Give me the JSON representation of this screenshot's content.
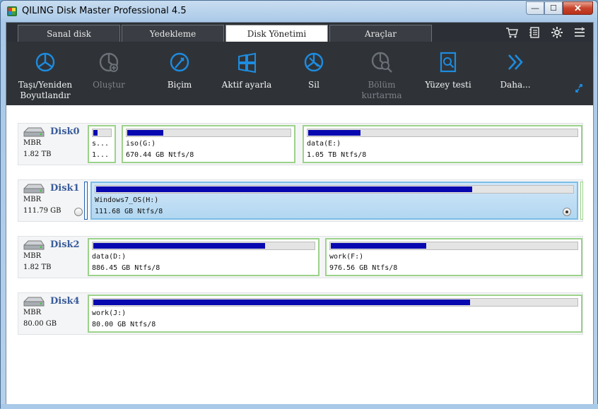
{
  "window": {
    "title": "QILING Disk Master Professional 4.5",
    "min": "—",
    "max": "☐",
    "close": "✕"
  },
  "tabs": [
    {
      "label": "Sanal disk"
    },
    {
      "label": "Yedekleme"
    },
    {
      "label": "Disk Yönetimi"
    },
    {
      "label": "Araçlar"
    }
  ],
  "active_tab": "Disk Yönetimi",
  "toolbar": {
    "items": [
      {
        "label": "Taşı/Yeniden\nBoyutlandır",
        "enabled": true
      },
      {
        "label": "Oluştur",
        "enabled": false
      },
      {
        "label": "Biçim",
        "enabled": true
      },
      {
        "label": "Aktif ayarla",
        "enabled": true
      },
      {
        "label": "Sil",
        "enabled": true
      },
      {
        "label": "Bölüm\nkurtarma",
        "enabled": false
      },
      {
        "label": "Yüzey testi",
        "enabled": true
      },
      {
        "label": "Daha...",
        "enabled": true
      }
    ]
  },
  "colors": {
    "accent": "#1d8ce0",
    "bar_fill": "#0808b0",
    "part_border": "#9cd28a"
  },
  "disks": [
    {
      "name": "Disk0",
      "type": "MBR",
      "size": "1.82 TB",
      "partitions": [
        {
          "label": "s...",
          "size": "1...",
          "used": 0.3
        },
        {
          "label": "iso(G:)",
          "size": "670.44 GB Ntfs/8",
          "used": 0.23
        },
        {
          "label": "data(E:)",
          "size": "1.05 TB Ntfs/8",
          "used": 0.2
        }
      ]
    },
    {
      "name": "Disk1",
      "type": "MBR",
      "size": "111.79 GB",
      "partitions": [
        {
          "label": "Windows7_OS(H:)",
          "size": "111.68 GB Ntfs/8",
          "used": 0.79
        }
      ]
    },
    {
      "name": "Disk2",
      "type": "MBR",
      "size": "1.82 TB",
      "partitions": [
        {
          "label": "data(D:)",
          "size": "886.45 GB Ntfs/8",
          "used": 0.78
        },
        {
          "label": "work(F:)",
          "size": "976.56 GB Ntfs/8",
          "used": 0.39
        }
      ]
    },
    {
      "name": "Disk4",
      "type": "MBR",
      "size": "80.00 GB",
      "partitions": [
        {
          "label": "work(J:)",
          "size": "80.00 GB Ntfs/8",
          "used": 0.78
        }
      ]
    }
  ]
}
